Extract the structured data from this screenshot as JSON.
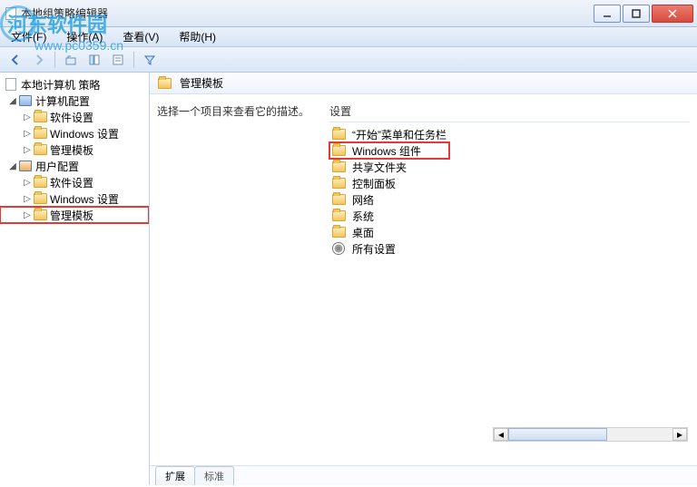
{
  "watermark": {
    "main": "河东软件园",
    "sub": "www.pc0359.cn"
  },
  "titlebar": {
    "title": "本地组策略编辑器"
  },
  "menu": {
    "file": "文件(F)",
    "action": "操作(A)",
    "view": "查看(V)",
    "help": "帮助(H)"
  },
  "tree": {
    "root": "本地计算机 策略",
    "computer_config": "计算机配置",
    "software_settings": "软件设置",
    "windows_settings": "Windows 设置",
    "admin_templates": "管理模板",
    "user_config": "用户配置"
  },
  "content": {
    "header": "管理模板",
    "description_prompt": "选择一个项目来查看它的描述。",
    "settings_header": "设置",
    "items": [
      "“开始”菜单和任务栏",
      "Windows 组件",
      "共享文件夹",
      "控制面板",
      "网络",
      "系统",
      "桌面",
      "所有设置"
    ]
  },
  "tabs": {
    "extended": "扩展",
    "standard": "标准"
  }
}
